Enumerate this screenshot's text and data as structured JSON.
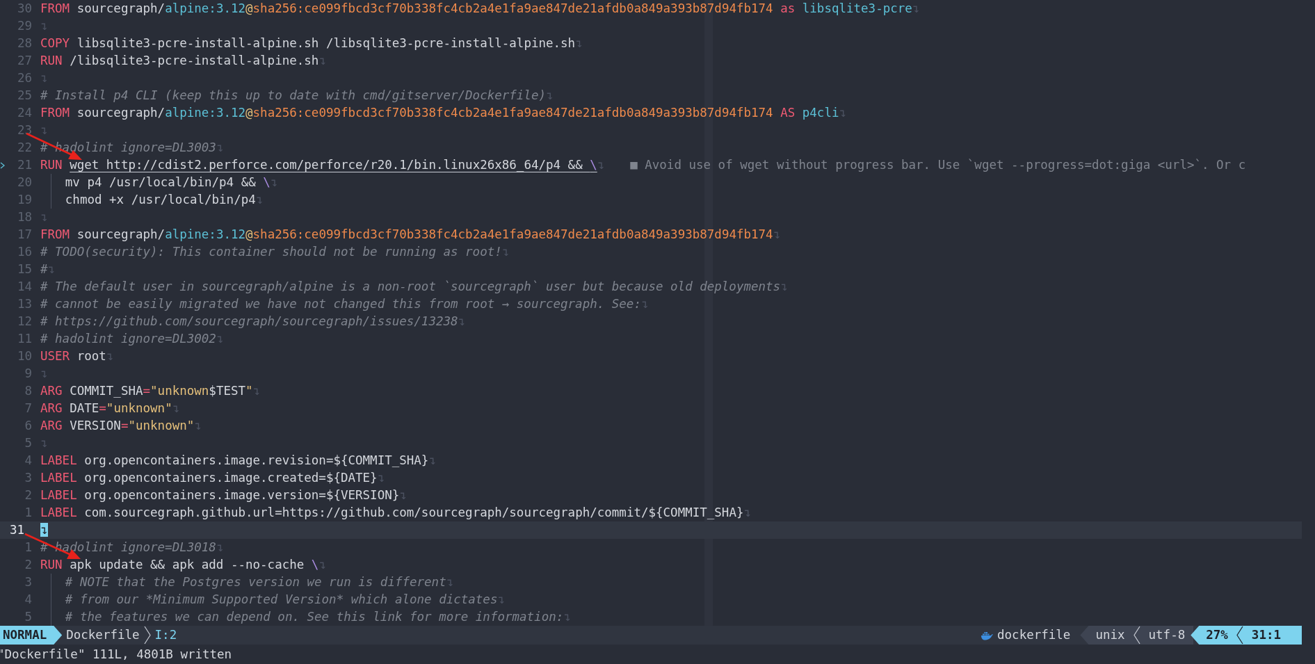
{
  "lines": [
    {
      "number": "30",
      "current": false,
      "guide": false,
      "tokens": [
        {
          "kind": "keyword",
          "text": "FROM"
        },
        {
          "kind": "text",
          "text": " sourcegraph/"
        },
        {
          "kind": "name",
          "text": "alpine:3.12"
        },
        {
          "kind": "at",
          "text": "@"
        },
        {
          "kind": "hash",
          "text": "sha256:ce099fbcd3cf70b338fc4cb2a4e1fa9ae847de21afdb0a849a393b87d94fb174"
        },
        {
          "kind": "keyword",
          "text": " as"
        },
        {
          "kind": "name",
          "text": " libsqlite3-pcre"
        }
      ],
      "eol": "↴"
    },
    {
      "number": "29",
      "current": false,
      "guide": false,
      "eol": "↴"
    },
    {
      "number": "28",
      "current": false,
      "guide": false,
      "tokens": [
        {
          "kind": "keyword",
          "text": "COPY"
        },
        {
          "kind": "text",
          "text": " libsqlite3-pcre-install-alpine.sh /libsqlite3-pcre-install-alpine.sh"
        }
      ],
      "eol": "↴"
    },
    {
      "number": "27",
      "current": false,
      "guide": false,
      "tokens": [
        {
          "kind": "keyword",
          "text": "RUN"
        },
        {
          "kind": "text",
          "text": " /libsqlite3-pcre-install-alpine.sh"
        }
      ],
      "eol": "↴"
    },
    {
      "number": "26",
      "current": false,
      "guide": false,
      "eol": "↴"
    },
    {
      "number": "25",
      "current": false,
      "guide": false,
      "tokens": [
        {
          "kind": "comment",
          "text": "# Install p4 CLI (keep this up to date with cmd/gitserver/Dockerfile)"
        }
      ],
      "eol": "↴"
    },
    {
      "number": "24",
      "current": false,
      "guide": false,
      "tokens": [
        {
          "kind": "keyword",
          "text": "FROM"
        },
        {
          "kind": "text",
          "text": " sourcegraph/"
        },
        {
          "kind": "name",
          "text": "alpine:3.12"
        },
        {
          "kind": "at",
          "text": "@"
        },
        {
          "kind": "hash",
          "text": "sha256:ce099fbcd3cf70b338fc4cb2a4e1fa9ae847de21afdb0a849a393b87d94fb174"
        },
        {
          "kind": "keyword",
          "text": " AS"
        },
        {
          "kind": "name",
          "text": " p4cli"
        }
      ],
      "eol": "↴"
    },
    {
      "number": "23",
      "current": false,
      "guide": false,
      "eol": "↴"
    },
    {
      "number": "22",
      "current": false,
      "guide": false,
      "tokens": [
        {
          "kind": "comment",
          "text": "# hadolint ignore=DL3003"
        }
      ],
      "eol": "↴"
    },
    {
      "number": "21",
      "current": false,
      "guide": false,
      "tokens": [
        {
          "kind": "keyword",
          "text": "RUN "
        },
        {
          "kind": "text",
          "text": "wget http://cdist2.perforce.com/perforce/r20.1/bin.linux26x86_64/p4 && ",
          "underline": true
        },
        {
          "kind": "escape",
          "text": "\\",
          "underline": true
        }
      ],
      "eol": "↴",
      "diagnostic": "■ Avoid use of wget without progress bar. Use `wget --progress=dot:giga <url>`. Or c"
    },
    {
      "number": "20",
      "current": false,
      "guide": true,
      "tokens": [
        {
          "kind": "text",
          "text": "mv p4 /usr/local/bin/p4 && "
        },
        {
          "kind": "escape",
          "text": "\\"
        }
      ],
      "eol": "↴"
    },
    {
      "number": "19",
      "current": false,
      "guide": true,
      "tokens": [
        {
          "kind": "text",
          "text": "chmod +x /usr/local/bin/p4"
        }
      ],
      "eol": "↴"
    },
    {
      "number": "18",
      "current": false,
      "guide": false,
      "eol": "↴"
    },
    {
      "number": "17",
      "current": false,
      "guide": false,
      "tokens": [
        {
          "kind": "keyword",
          "text": "FROM"
        },
        {
          "kind": "text",
          "text": " sourcegraph/"
        },
        {
          "kind": "name",
          "text": "alpine:3.12"
        },
        {
          "kind": "at",
          "text": "@"
        },
        {
          "kind": "hash",
          "text": "sha256:ce099fbcd3cf70b338fc4cb2a4e1fa9ae847de21afdb0a849a393b87d94fb174"
        }
      ],
      "eol": "↴"
    },
    {
      "number": "16",
      "current": false,
      "guide": false,
      "tokens": [
        {
          "kind": "comment",
          "text": "# TODO(security): This container should not be running as root!"
        }
      ],
      "eol": "↴"
    },
    {
      "number": "15",
      "current": false,
      "guide": false,
      "tokens": [
        {
          "kind": "comment",
          "text": "#"
        }
      ],
      "eol": "↴"
    },
    {
      "number": "14",
      "current": false,
      "guide": false,
      "tokens": [
        {
          "kind": "comment",
          "text": "# The default user in sourcegraph/alpine is a non-root `sourcegraph` user but because old deployments"
        }
      ],
      "eol": "↴"
    },
    {
      "number": "13",
      "current": false,
      "guide": false,
      "tokens": [
        {
          "kind": "comment",
          "text": "# cannot be easily migrated we have not changed this from root → sourcegraph. See:"
        }
      ],
      "eol": "↴"
    },
    {
      "number": "12",
      "current": false,
      "guide": false,
      "tokens": [
        {
          "kind": "comment",
          "text": "# https://github.com/sourcegraph/sourcegraph/issues/13238"
        }
      ],
      "eol": "↴"
    },
    {
      "number": "11",
      "current": false,
      "guide": false,
      "tokens": [
        {
          "kind": "comment",
          "text": "# hadolint ignore=DL3002"
        }
      ],
      "eol": "↴"
    },
    {
      "number": "10",
      "current": false,
      "guide": false,
      "tokens": [
        {
          "kind": "keyword",
          "text": "USER"
        },
        {
          "kind": "text",
          "text": " root"
        }
      ],
      "eol": "↴"
    },
    {
      "number": "9",
      "current": false,
      "guide": false,
      "eol": "↴"
    },
    {
      "number": "8",
      "current": false,
      "guide": false,
      "tokens": [
        {
          "kind": "keyword",
          "text": "ARG"
        },
        {
          "kind": "text",
          "text": " COMMIT_SHA"
        },
        {
          "kind": "op",
          "text": "="
        },
        {
          "kind": "string",
          "text": "\"unknown"
        },
        {
          "kind": "text",
          "text": "$TEST"
        },
        {
          "kind": "string",
          "text": "\""
        }
      ],
      "eol": "↴"
    },
    {
      "number": "7",
      "current": false,
      "guide": false,
      "tokens": [
        {
          "kind": "keyword",
          "text": "ARG"
        },
        {
          "kind": "text",
          "text": " DATE"
        },
        {
          "kind": "op",
          "text": "="
        },
        {
          "kind": "string",
          "text": "\"unknown\""
        }
      ],
      "eol": "↴"
    },
    {
      "number": "6",
      "current": false,
      "guide": false,
      "tokens": [
        {
          "kind": "keyword",
          "text": "ARG"
        },
        {
          "kind": "text",
          "text": " VERSION"
        },
        {
          "kind": "op",
          "text": "="
        },
        {
          "kind": "string",
          "text": "\"unknown\""
        }
      ],
      "eol": "↴"
    },
    {
      "number": "5",
      "current": false,
      "guide": false,
      "eol": "↴"
    },
    {
      "number": "4",
      "current": false,
      "guide": false,
      "tokens": [
        {
          "kind": "keyword",
          "text": "LABEL"
        },
        {
          "kind": "text",
          "text": " org.opencontainers.image.revision=${COMMIT_SHA}"
        }
      ],
      "eol": "↴"
    },
    {
      "number": "3",
      "current": false,
      "guide": false,
      "tokens": [
        {
          "kind": "keyword",
          "text": "LABEL"
        },
        {
          "kind": "text",
          "text": " org.opencontainers.image.created=${DATE}"
        }
      ],
      "eol": "↴"
    },
    {
      "number": "2",
      "current": false,
      "guide": false,
      "tokens": [
        {
          "kind": "keyword",
          "text": "LABEL"
        },
        {
          "kind": "text",
          "text": " org.opencontainers.image.version=${VERSION}"
        }
      ],
      "eol": "↴"
    },
    {
      "number": "1",
      "current": false,
      "guide": false,
      "tokens": [
        {
          "kind": "keyword",
          "text": "LABEL"
        },
        {
          "kind": "text",
          "text": " com.sourcegraph.github.url=https://github.com/sourcegraph/sourcegraph/commit/${COMMIT_SHA}"
        }
      ],
      "eol": "↴"
    },
    {
      "number": "31",
      "current": true,
      "guide": false,
      "eol": "↴"
    },
    {
      "number": "1",
      "current": false,
      "guide": false,
      "tokens": [
        {
          "kind": "comment",
          "text": "# hadolint ignore=DL3018"
        }
      ],
      "eol": "↴"
    },
    {
      "number": "2",
      "current": false,
      "guide": false,
      "tokens": [
        {
          "kind": "keyword",
          "text": "RUN"
        },
        {
          "kind": "text",
          "text": " apk update && apk add --no-cache "
        },
        {
          "kind": "escape",
          "text": "\\"
        }
      ],
      "eol": "↴"
    },
    {
      "number": "3",
      "current": false,
      "guide": true,
      "tokens": [
        {
          "kind": "comment",
          "text": "# NOTE that the Postgres version we run is different"
        }
      ],
      "eol": "↴"
    },
    {
      "number": "4",
      "current": false,
      "guide": true,
      "tokens": [
        {
          "kind": "comment",
          "text": "# from our *Minimum Supported Version* which alone dictates"
        }
      ],
      "eol": "↴"
    },
    {
      "number": "5",
      "current": false,
      "guide": true,
      "tokens": [
        {
          "kind": "comment",
          "text": "# the features we can depend on. See this link for more information:"
        }
      ],
      "eol": "↴"
    }
  ],
  "status_bar": {
    "mode": "NORMAL",
    "file": "Dockerfile",
    "info": "I:2",
    "filetype": "dockerfile",
    "format": "unix",
    "encoding": "utf-8",
    "percent": "27%",
    "position": "31:1"
  },
  "command_line": "\"Dockerfile\" 111L, 4801B written"
}
